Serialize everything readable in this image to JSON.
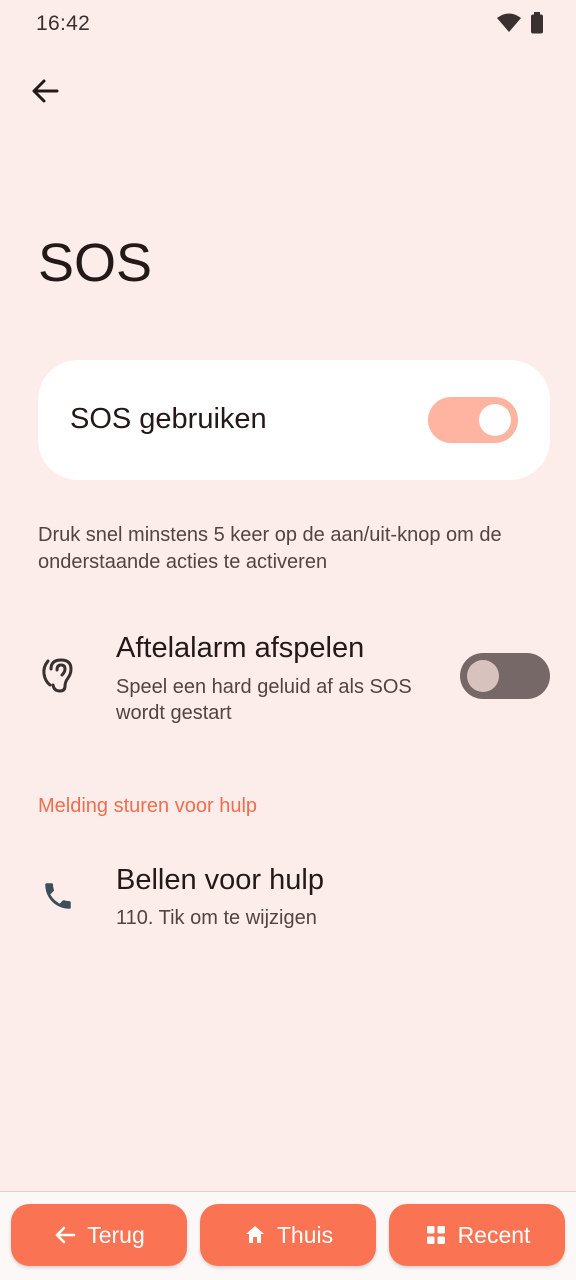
{
  "status_bar": {
    "time": "16:42",
    "icons": [
      "wifi-icon",
      "battery-icon"
    ]
  },
  "header": {
    "back_icon": "arrow-left-icon",
    "title": "SOS"
  },
  "main_toggle": {
    "label": "SOS gebruiken",
    "enabled": true
  },
  "description": "Druk snel minstens 5 keer op de aan/uit-knop om de onderstaande acties te activeren",
  "countdown_alarm": {
    "icon": "ear-icon",
    "title": "Aftelalarm afspelen",
    "subtitle": "Speel een hard geluid af als SOS wordt gestart",
    "enabled": false
  },
  "section": {
    "header": "Melding sturen voor hulp"
  },
  "call_help": {
    "icon": "phone-icon",
    "title": "Bellen voor hulp",
    "subtitle": "110. Tik om te wijzigen"
  },
  "nav": {
    "back_label": "Terug",
    "home_label": "Thuis",
    "recent_label": "Recent"
  },
  "colors": {
    "background": "#fcedea",
    "accent": "#fa7454",
    "section_header": "#f06e4e",
    "switch_on": "#ffb4a1",
    "switch_off": "#766866"
  }
}
